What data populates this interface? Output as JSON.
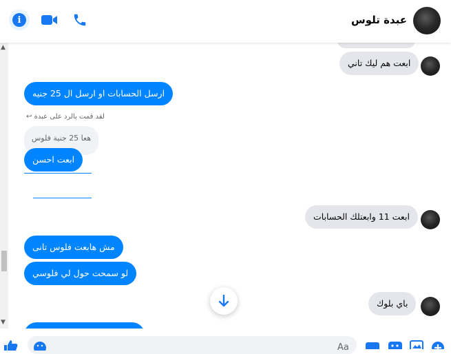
{
  "header": {
    "contact_name": "عبدة تلوس",
    "icons": [
      "info-icon",
      "video-icon",
      "phone-icon"
    ]
  },
  "messages": [
    {
      "from": "contact",
      "text": "ابعت هم ليك تاني"
    },
    {
      "from": "me",
      "text": "ارسل الحسابات او ارسل ال 25 جنيه"
    },
    {
      "from": "me",
      "reply_note": "لقد قمت بالرد على عبدة",
      "quoted": "هعا 25 جنية فلوس",
      "text": "ابعت احسن"
    },
    {
      "from": "contact",
      "text": "ابعت 11 وابعتلك الحسابات"
    },
    {
      "from": "me",
      "text": "مش هابعت فلوس تانى"
    },
    {
      "from": "me",
      "text": "لو سمحت حول لي فلوسي"
    },
    {
      "from": "contact",
      "text": "باي بلوك"
    }
  ],
  "composer": {
    "placeholder": "Aa"
  },
  "colors": {
    "accent": "#0084ff",
    "brand": "#1877f2",
    "incoming": "#e4e6eb"
  }
}
